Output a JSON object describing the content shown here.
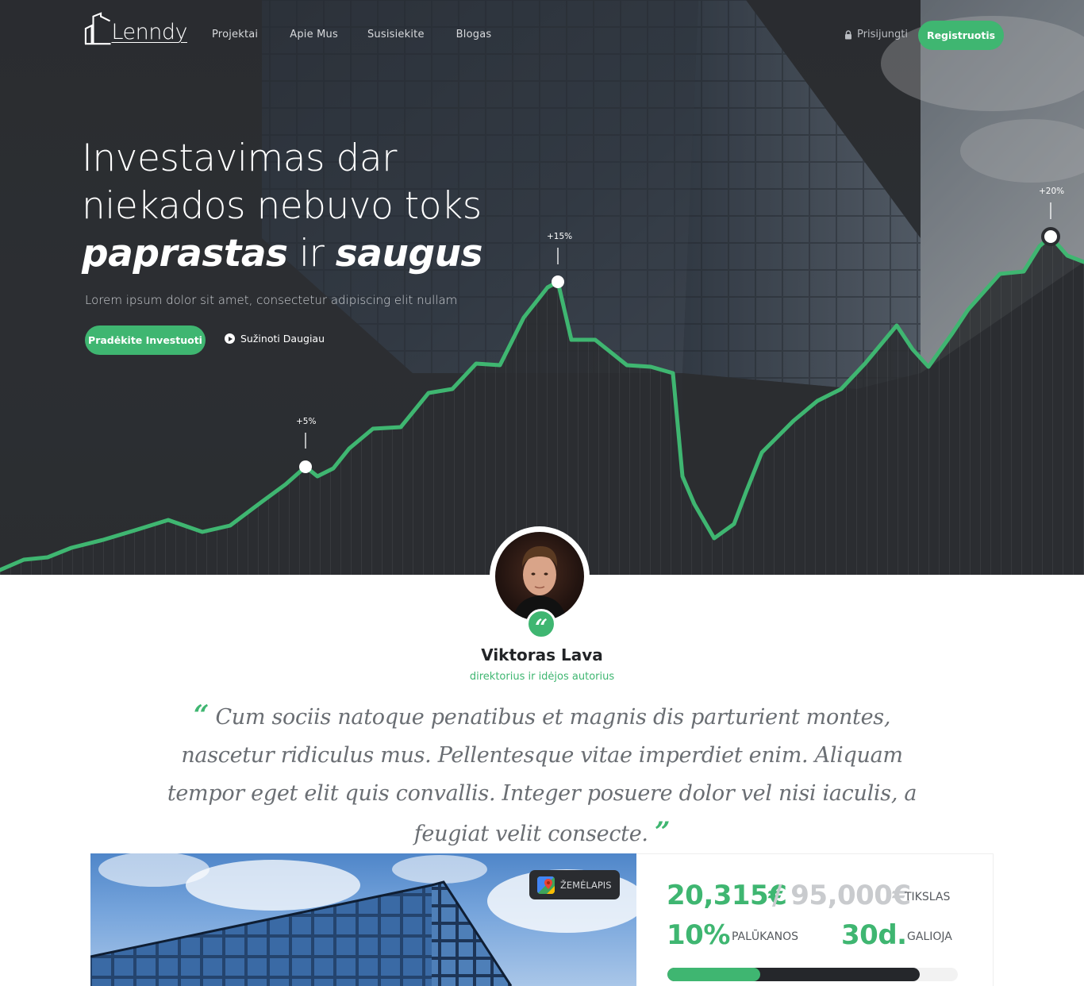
{
  "header": {
    "logo_text": "Lenndy",
    "nav": [
      "Projektai",
      "Apie Mus",
      "Susisiekite",
      "Blogas"
    ],
    "login_label": "Prisijungti",
    "register_label": "Registruotis"
  },
  "hero": {
    "headline_line1": "Investavimas dar",
    "headline_line2": "niekados nebuvo toks",
    "headline_em1": "paprastas",
    "headline_mid": " ir ",
    "headline_em2": "saugus",
    "subtitle": "Lorem ipsum dolor sit amet, consectetur adipiscing elit nullam",
    "cta_label": "Pradėkite Investuoti",
    "more_label": "Sužinoti Daugiau",
    "markers": [
      "+5%",
      "+15%",
      "+20%"
    ],
    "line_color": "#3fb671"
  },
  "testimonial": {
    "name": "Viktoras Lava",
    "role": "direktorius ir idėjos autorius",
    "open_quote": "“",
    "close_quote": "”",
    "text": "Cum sociis natoque penatibus et magnis dis parturient montes, nascetur ridiculus mus. Pellentesque vitae imperdiet enim. Aliquam tempor eget elit quis convallis. Integer posuere dolor vel nisi iaculis, a feugiat velit consecte."
  },
  "project": {
    "map_label": "ŽEMĖLAPIS",
    "raised": "20,315€",
    "goal": "/ 95,000€",
    "goal_label": "TIKSLAS",
    "rate": "10%",
    "rate_label": "PALŪKANOS",
    "days": "30d.",
    "days_label": "GALIOJA",
    "progress_funded": 0.32,
    "progress_reserved": 0.87
  },
  "colors": {
    "accent": "#3fb671",
    "dark": "#2b2d31"
  }
}
